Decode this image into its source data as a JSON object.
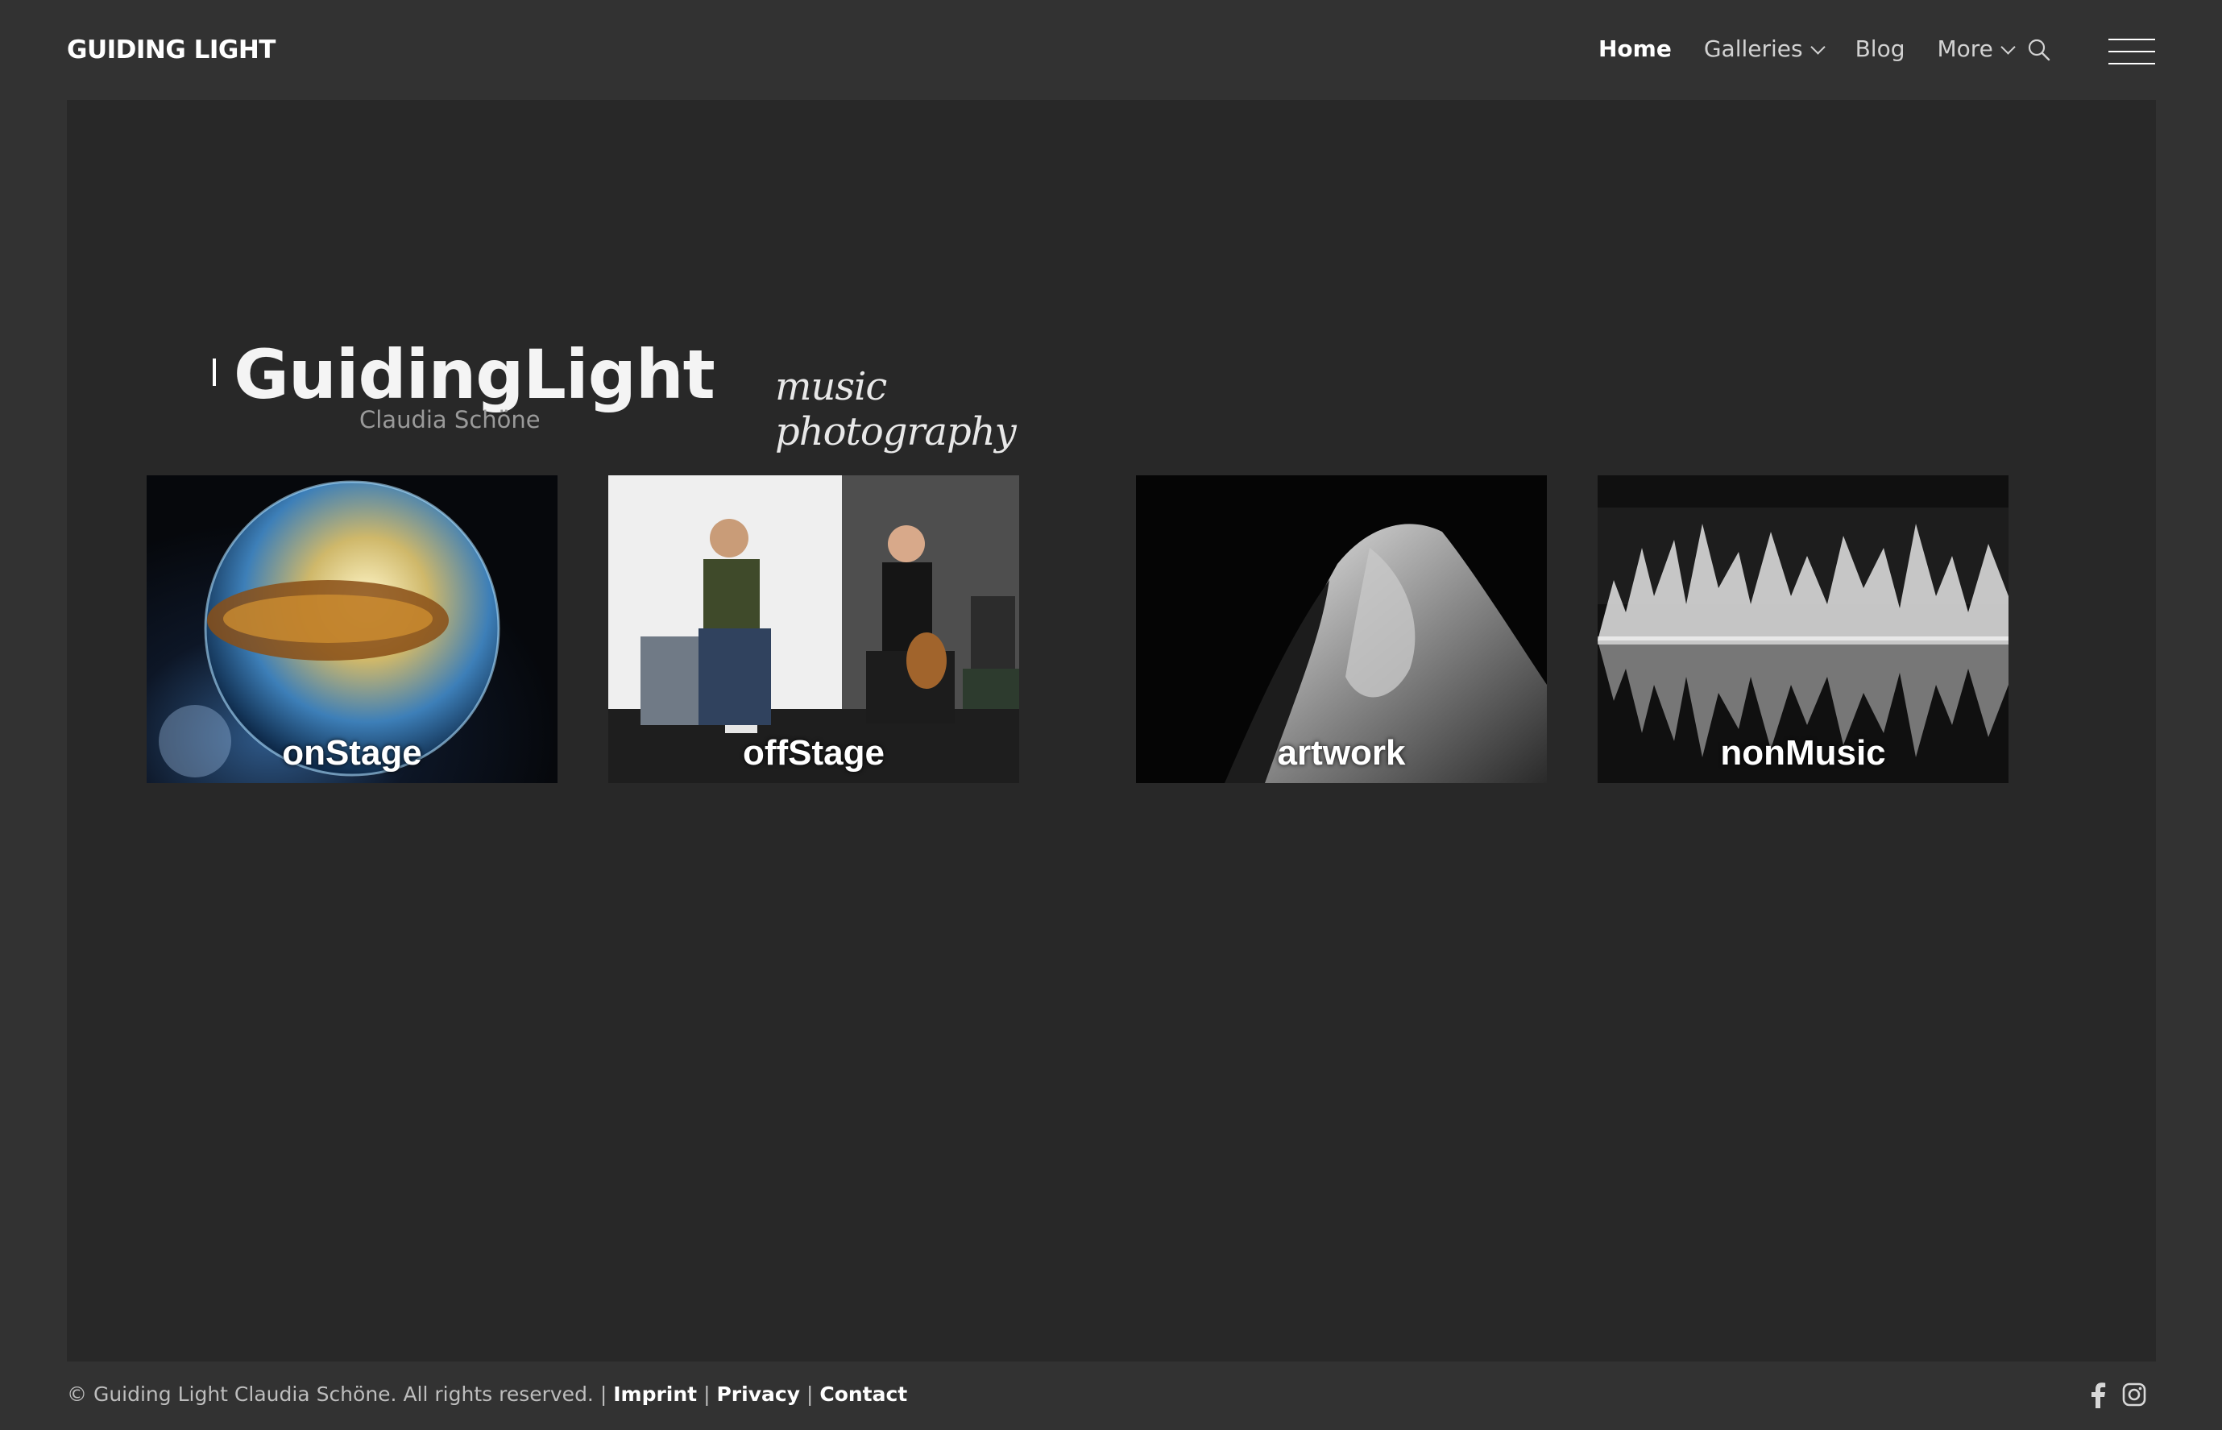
{
  "header": {
    "site_title": "GUIDING LIGHT",
    "nav": [
      {
        "label": "Home",
        "active": true,
        "dropdown": false
      },
      {
        "label": "Galleries",
        "active": false,
        "dropdown": true
      },
      {
        "label": "Blog",
        "active": false,
        "dropdown": false
      },
      {
        "label": "More",
        "active": false,
        "dropdown": true
      }
    ],
    "search_icon": "search-icon",
    "menu_icon": "hamburger-menu-icon"
  },
  "brand": {
    "title": "GuidingLight",
    "subtitle": "Claudia Schöne",
    "tagline": "music photography"
  },
  "galleries": [
    {
      "label": "onStage",
      "image": "glass sphere on dark background"
    },
    {
      "label": "offStage",
      "image": "two musicians with keyboard and guitar"
    },
    {
      "label": "artwork",
      "image": "black and white stone sculpture"
    },
    {
      "label": "nonMusic",
      "image": "mirrored ice structures"
    }
  ],
  "footer": {
    "copyright": "© Guiding Light Claudia Schöne. All rights reserved.",
    "sep": "|",
    "links": [
      "Imprint",
      "Privacy",
      "Contact"
    ],
    "social": [
      "facebook-icon",
      "instagram-icon"
    ]
  },
  "colors": {
    "page_bg": "#323232",
    "panel_bg": "#282828",
    "text": "#ffffff",
    "muted": "#bdbdbd"
  }
}
